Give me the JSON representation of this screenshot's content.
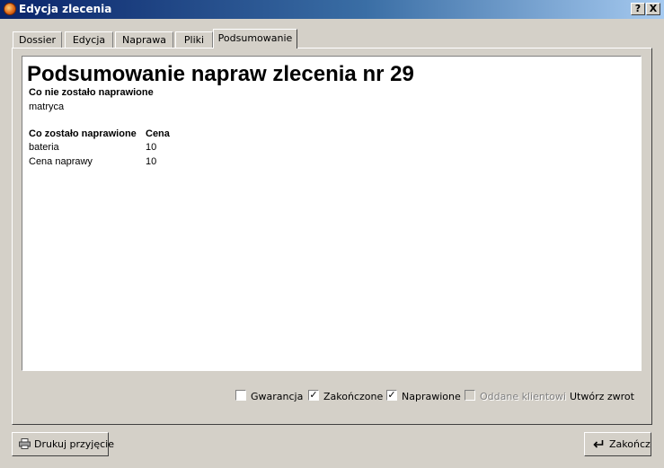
{
  "window": {
    "title": "Edycja zlecenia",
    "help_label": "?",
    "close_label": "X"
  },
  "tabs": [
    "Dossier",
    "Edycja",
    "Naprawa",
    "Pliki",
    "Podsumowanie"
  ],
  "active_tab": "Podsumowanie",
  "summary": {
    "heading": "Podsumowanie napraw zlecenia nr 29",
    "not_repaired_header": "Co nie zostało naprawione",
    "not_repaired_items": [
      "matryca"
    ],
    "repaired_header": "Co zostało naprawione",
    "price_header": "Cena",
    "repaired_items": [
      {
        "name": "bateria",
        "price": "10"
      },
      {
        "name": "Cena naprawy",
        "price": "10"
      }
    ]
  },
  "options": {
    "guarantee": {
      "label": "Gwarancja",
      "checked": false
    },
    "finished": {
      "label": "Zakończone",
      "checked": true
    },
    "repaired": {
      "label": "Naprawione",
      "checked": true
    },
    "returned": {
      "label": "Oddane klientowi",
      "checked": false,
      "disabled": true
    },
    "create_return_label": "Utwórz zwrot"
  },
  "buttons": {
    "print_label": "Drukuj przyjęcie",
    "finish_label": "Zakończ"
  }
}
